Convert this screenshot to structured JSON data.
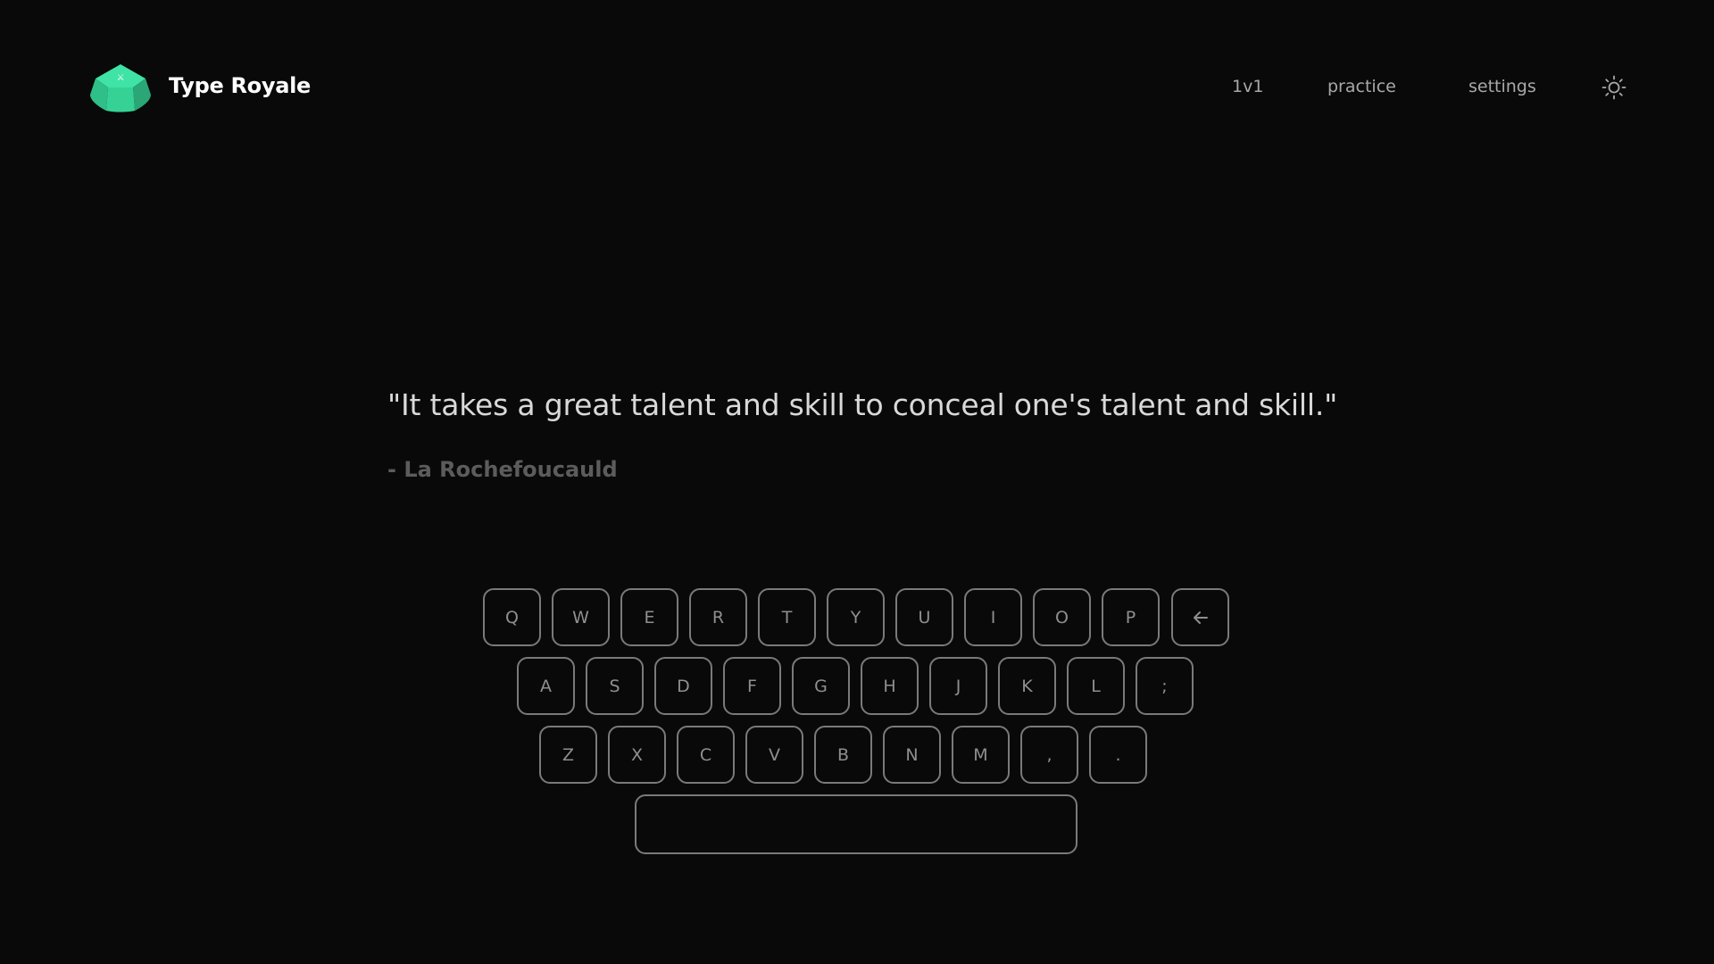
{
  "brand": {
    "name": "Type Royale",
    "logo_icon": "keycap-logo-icon",
    "accent_color": "#3ddc97"
  },
  "nav": {
    "items": [
      {
        "label": "1v1"
      },
      {
        "label": "practice"
      },
      {
        "label": "settings"
      }
    ],
    "theme_toggle_icon": "sun-icon"
  },
  "quote": {
    "text": "\"It takes a great talent and skill to conceal one's talent and skill.\"",
    "author": "- La Rochefoucauld"
  },
  "keyboard": {
    "rows": [
      [
        "Q",
        "W",
        "E",
        "R",
        "T",
        "Y",
        "U",
        "I",
        "O",
        "P"
      ],
      [
        "A",
        "S",
        "D",
        "F",
        "G",
        "H",
        "J",
        "K",
        "L",
        ";"
      ],
      [
        "Z",
        "X",
        "C",
        "V",
        "B",
        "N",
        "M",
        ",",
        "."
      ]
    ],
    "backspace_icon": "arrow-left-icon",
    "space_label": ""
  }
}
